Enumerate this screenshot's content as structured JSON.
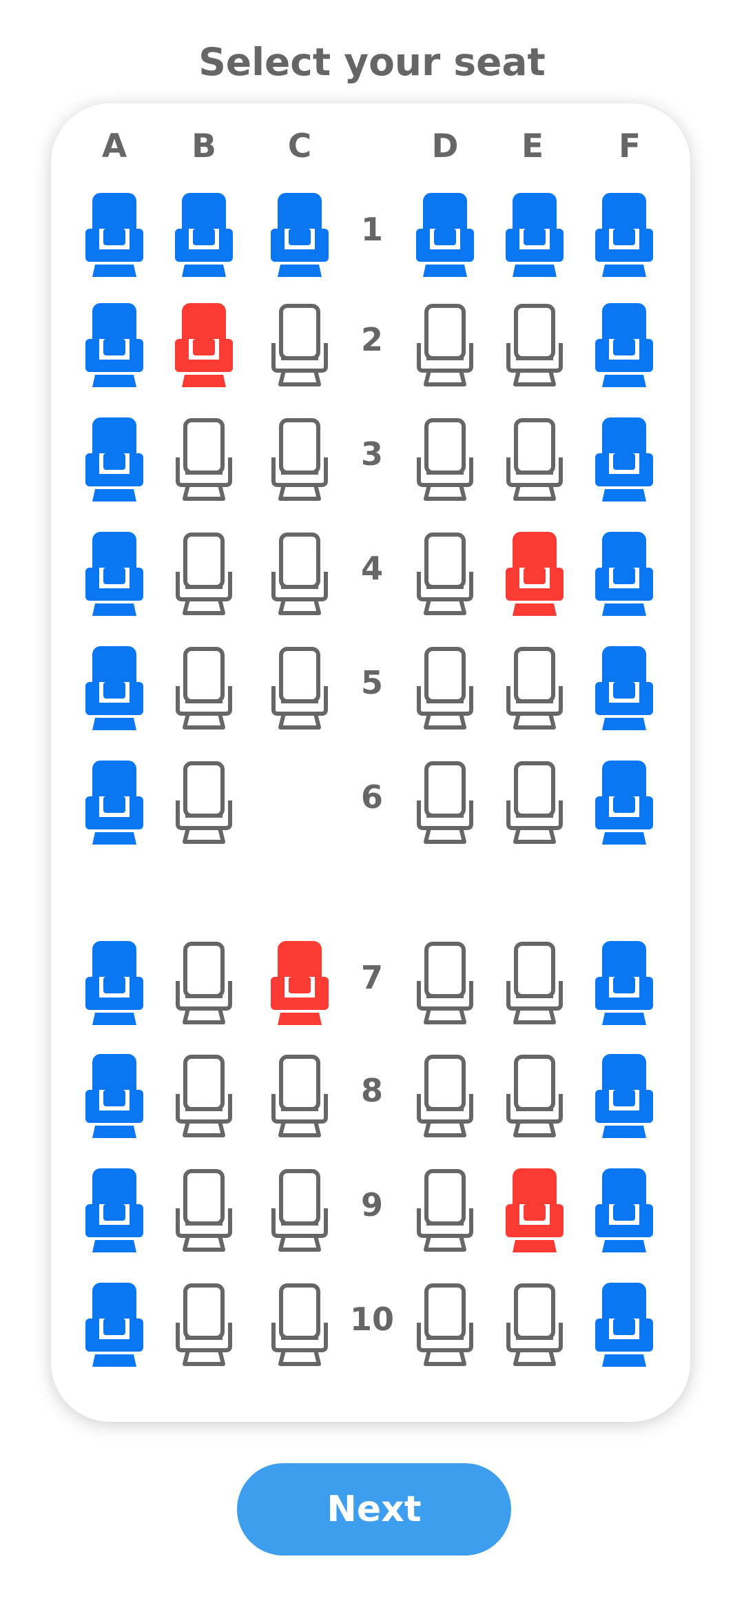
{
  "header": {
    "title": "Select your seat"
  },
  "colors": {
    "window_seat": "#0a76f2",
    "selected_seat": "#fb3a34",
    "available_outline": "#666666",
    "text": "#666666",
    "button_bg": "#3d9ef0",
    "button_text": "#ffffff"
  },
  "columns": [
    "A",
    "B",
    "C",
    "D",
    "E",
    "F"
  ],
  "rows": [
    {
      "label": "1",
      "seats": [
        "window",
        "window",
        "window",
        "window",
        "window",
        "window"
      ]
    },
    {
      "label": "2",
      "seats": [
        "window",
        "selected",
        "available",
        "available",
        "available",
        "window"
      ]
    },
    {
      "label": "3",
      "seats": [
        "window",
        "available",
        "available",
        "available",
        "available",
        "window"
      ]
    },
    {
      "label": "4",
      "seats": [
        "window",
        "available",
        "available",
        "available",
        "selected",
        "window"
      ]
    },
    {
      "label": "5",
      "seats": [
        "window",
        "available",
        "available",
        "available",
        "available",
        "window"
      ]
    },
    {
      "label": "6",
      "seats": [
        "window",
        "available",
        "none",
        "available",
        "available",
        "window"
      ]
    },
    {
      "label": "7",
      "seats": [
        "window",
        "available",
        "selected",
        "available",
        "available",
        "window"
      ]
    },
    {
      "label": "8",
      "seats": [
        "window",
        "available",
        "available",
        "available",
        "available",
        "window"
      ]
    },
    {
      "label": "9",
      "seats": [
        "window",
        "available",
        "available",
        "available",
        "selected",
        "window"
      ]
    },
    {
      "label": "10",
      "seats": [
        "window",
        "available",
        "available",
        "available",
        "available",
        "window"
      ]
    }
  ],
  "footer": {
    "next_label": "Next"
  },
  "icons": {
    "seat_filled": "seat-icon",
    "seat_outline": "seat-outline-icon"
  }
}
